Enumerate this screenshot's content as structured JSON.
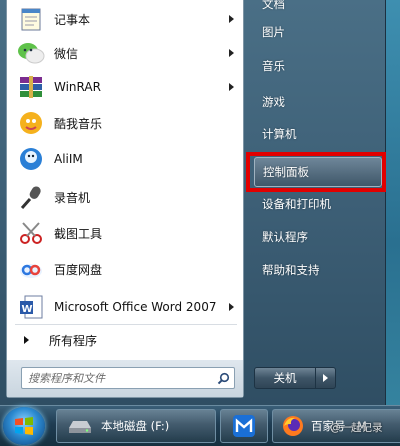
{
  "programs": [
    {
      "label": "记事本",
      "icon": "notepad-icon",
      "submenu": true
    },
    {
      "label": "微信",
      "icon": "wechat-icon",
      "submenu": true
    },
    {
      "label": "WinRAR",
      "icon": "winrar-icon",
      "submenu": true
    },
    {
      "label": "酷我音乐",
      "icon": "kuwo-music-icon",
      "submenu": false
    },
    {
      "label": "AliIM",
      "icon": "aliim-icon",
      "submenu": false
    },
    {
      "label": "录音机",
      "icon": "microphone-icon",
      "submenu": false
    },
    {
      "label": "截图工具",
      "icon": "snipping-tool-icon",
      "submenu": false
    },
    {
      "label": "百度网盘",
      "icon": "baidu-netdisk-icon",
      "submenu": false
    },
    {
      "label": "Microsoft Office Word 2007",
      "icon": "word-icon",
      "submenu": true
    }
  ],
  "all_programs_label": "所有程序",
  "search": {
    "placeholder": "搜索程序和文件"
  },
  "right_items": [
    {
      "label": "文档",
      "highlighted": false
    },
    {
      "label": "图片",
      "highlighted": false
    },
    {
      "label": "音乐",
      "highlighted": false
    },
    {
      "label": "游戏",
      "highlighted": false
    },
    {
      "label": "计算机",
      "highlighted": false
    },
    {
      "label": "控制面板",
      "highlighted": true
    },
    {
      "label": "设备和打印机",
      "highlighted": false
    },
    {
      "label": "默认程序",
      "highlighted": false
    },
    {
      "label": "帮助和支持",
      "highlighted": false
    }
  ],
  "shutdown_label": "关机",
  "taskbar": {
    "items": [
      {
        "label": "本地磁盘 (F:)",
        "icon": "drive-icon"
      },
      {
        "label": "",
        "icon": "maxthon-icon"
      },
      {
        "label": "百家号 - M",
        "icon": "firefox-icon"
      }
    ],
    "watermark": "@一起记录"
  },
  "colors": {
    "highlight_frame": "#e10000",
    "menu_bg": "#3d5f76"
  }
}
